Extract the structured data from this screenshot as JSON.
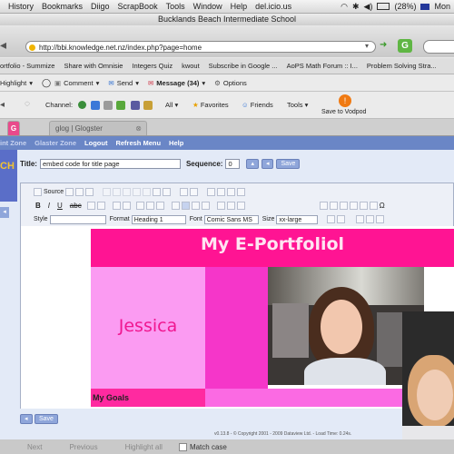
{
  "menu": {
    "items": [
      "History",
      "Bookmarks",
      "Diigo",
      "ScrapBook",
      "Tools",
      "Window",
      "Help",
      "del.icio.us"
    ],
    "battery": "(28%)",
    "clock_partial": "Mon"
  },
  "window": {
    "title": "Bucklands Beach Intermediate School"
  },
  "address": {
    "url": "http://bbi.knowledge.net.nz/index.php?page=home"
  },
  "bookmarks": [
    "ortfolio - Summize",
    "Share with Omnisie",
    "Integers Quiz",
    "kwout",
    "Subscribe in Google ...",
    "AoPS Math Forum :: I...",
    "Problem Solving Stra..."
  ],
  "toolbar1": {
    "highlight": "Highlight",
    "comment": "Comment",
    "send": "Send",
    "message": "Message (34)",
    "options": "Options"
  },
  "toolbar2": {
    "channel": "Channel:",
    "all": "All",
    "favorites": "Favorites",
    "friends": "Friends",
    "tools": "Tools",
    "save": "Save to Vodpod"
  },
  "tabs": [
    {
      "label": "glog | Glogster",
      "active": false
    },
    {
      "label": "G",
      "active": true
    }
  ],
  "site_nav": [
    "int Zone",
    "Glaster Zone",
    "Logout",
    "Refresh Menu",
    "Help"
  ],
  "side_label": "CH",
  "form": {
    "title_label": "Title:",
    "title_value": "embed code for title page",
    "sequence_label": "Sequence:",
    "sequence_value": "0",
    "save_label": "Save"
  },
  "editor": {
    "source": "Source",
    "style_label": "Style",
    "format_label": "Format",
    "format_value": "Heading 1",
    "font_label": "Font",
    "font_value": "Comic Sans MS",
    "size_label": "Size",
    "size_value": "xx-large"
  },
  "content": {
    "heading": "My E-Portfoliol",
    "name": "Jessica",
    "goals": "My Goals"
  },
  "footer": {
    "save_label": "Save",
    "copyright": "v0.13.8 - © Copyright 2001 - 2009 Dataview Ltd. - Load Time: 0.24s."
  },
  "findbar": {
    "next": "Next",
    "previous": "Previous",
    "highlight_all": "Highlight all",
    "match_case": "Match case"
  },
  "colors": {
    "hero_pink": "#ff1493",
    "light_pink": "#fb9bf2",
    "magenta": "#f536c9",
    "name_text": "#f01790",
    "nav_blue": "#6a86c6"
  }
}
